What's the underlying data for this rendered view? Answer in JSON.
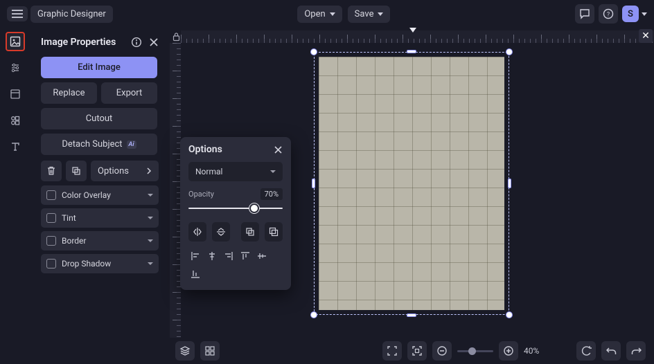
{
  "app_title": "Graphic Designer",
  "topbar": {
    "open": "Open",
    "save": "Save",
    "avatar": "S"
  },
  "props": {
    "title": "Image Properties",
    "edit": "Edit Image",
    "replace": "Replace",
    "export": "Export",
    "cutout": "Cutout",
    "detach": "Detach Subject",
    "ai": "Ai",
    "options": "Options",
    "accordion": [
      "Color Overlay",
      "Tint",
      "Border",
      "Drop Shadow"
    ]
  },
  "popover": {
    "title": "Options",
    "blend": "Normal",
    "opacity_label": "Opacity",
    "opacity_value": "70%",
    "opacity_pct": 70
  },
  "bottom": {
    "zoom": "40%",
    "zoom_pct": 40
  }
}
